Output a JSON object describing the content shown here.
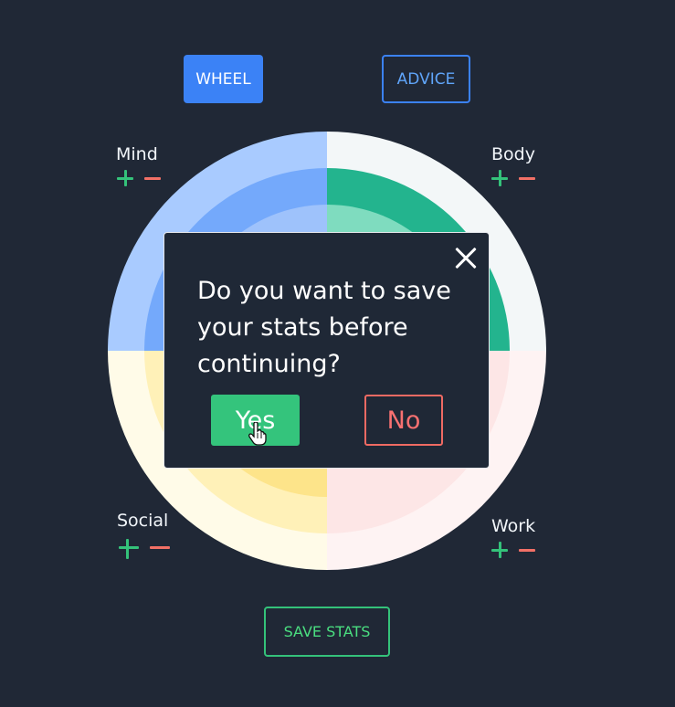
{
  "nav": {
    "wheel_label": "WHEEL",
    "advice_label": "ADVICE"
  },
  "categories": {
    "mind": {
      "label": "Mind"
    },
    "body": {
      "label": "Body"
    },
    "social": {
      "label": "Social"
    },
    "work": {
      "label": "Work"
    }
  },
  "controls": {
    "plus_icon": "plus-icon",
    "minus_icon": "minus-icon"
  },
  "colors": {
    "background": "#202836",
    "mind": [
      "#a9cbff",
      "#74a9fb",
      "#9ec2fb"
    ],
    "body": [
      "#f3f7f8",
      "#23b48e",
      "#7fdcbf"
    ],
    "social": [
      "#fffbe8",
      "#fff1b8",
      "#fde48a",
      "#fbbf14"
    ],
    "work": [
      "#fef3f3",
      "#fde6e6"
    ],
    "accent_blue": "#3b82f6",
    "accent_green": "#34c47c",
    "accent_red": "#ef6a63"
  },
  "modal": {
    "question": "Do you want to save your stats before continuing?",
    "yes_label": "Yes",
    "no_label": "No",
    "close_icon": "close-icon"
  },
  "footer": {
    "save_label": "SAVE STATS"
  }
}
